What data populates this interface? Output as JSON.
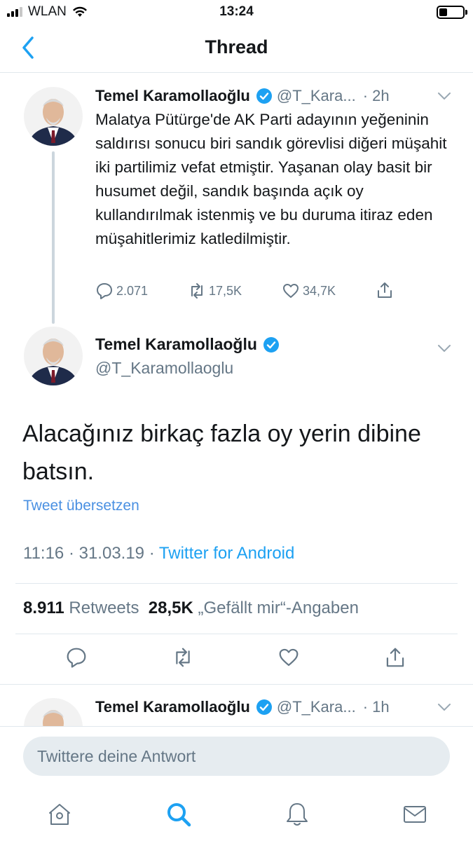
{
  "status_bar": {
    "carrier": "WLAN",
    "time": "13:24"
  },
  "nav": {
    "title": "Thread"
  },
  "colors": {
    "accent": "#1da1f2",
    "secondary_text": "#657786",
    "divider": "#e1e8ed"
  },
  "tweet1": {
    "name": "Temel Karamollaoğlu",
    "handle": "@T_Kara...",
    "time": "· 2h",
    "text": "Malatya Pütürge'de AK Parti adayının yeğeninin saldırısı sonucu biri sandık görevlisi diğeri müşahit iki partilimiz vefat etmiştir. Yaşanan olay basit bir husumet değil, sandık başında açık oy kullandırılmak istenmiş ve bu duruma itiraz eden müşahitlerimiz katledilmiştir.",
    "replies": "2.071",
    "retweets": "17,5K",
    "likes": "34,7K"
  },
  "tweet2": {
    "name": "Temel Karamollaoğlu",
    "handle": "@T_Karamollaoglu",
    "text": "Alacağınız birkaç fazla oy yerin dibine batsın.",
    "translate": "Tweet übersetzen",
    "timestamp": "11:16 · 31.03.19 · ",
    "source": "Twitter for Android",
    "retweet_count": "8.911",
    "retweet_label": "Retweets",
    "like_count": "28,5K",
    "like_label": "„Gefällt mir“-Angaben"
  },
  "tweet3": {
    "name": "Temel Karamollaoğlu",
    "handle": "@T_Kara...",
    "time": "· 1h"
  },
  "reply": {
    "placeholder": "Twittere deine Antwort"
  },
  "tabs": [
    "home-icon",
    "search-icon",
    "notifications-icon",
    "messages-icon"
  ]
}
